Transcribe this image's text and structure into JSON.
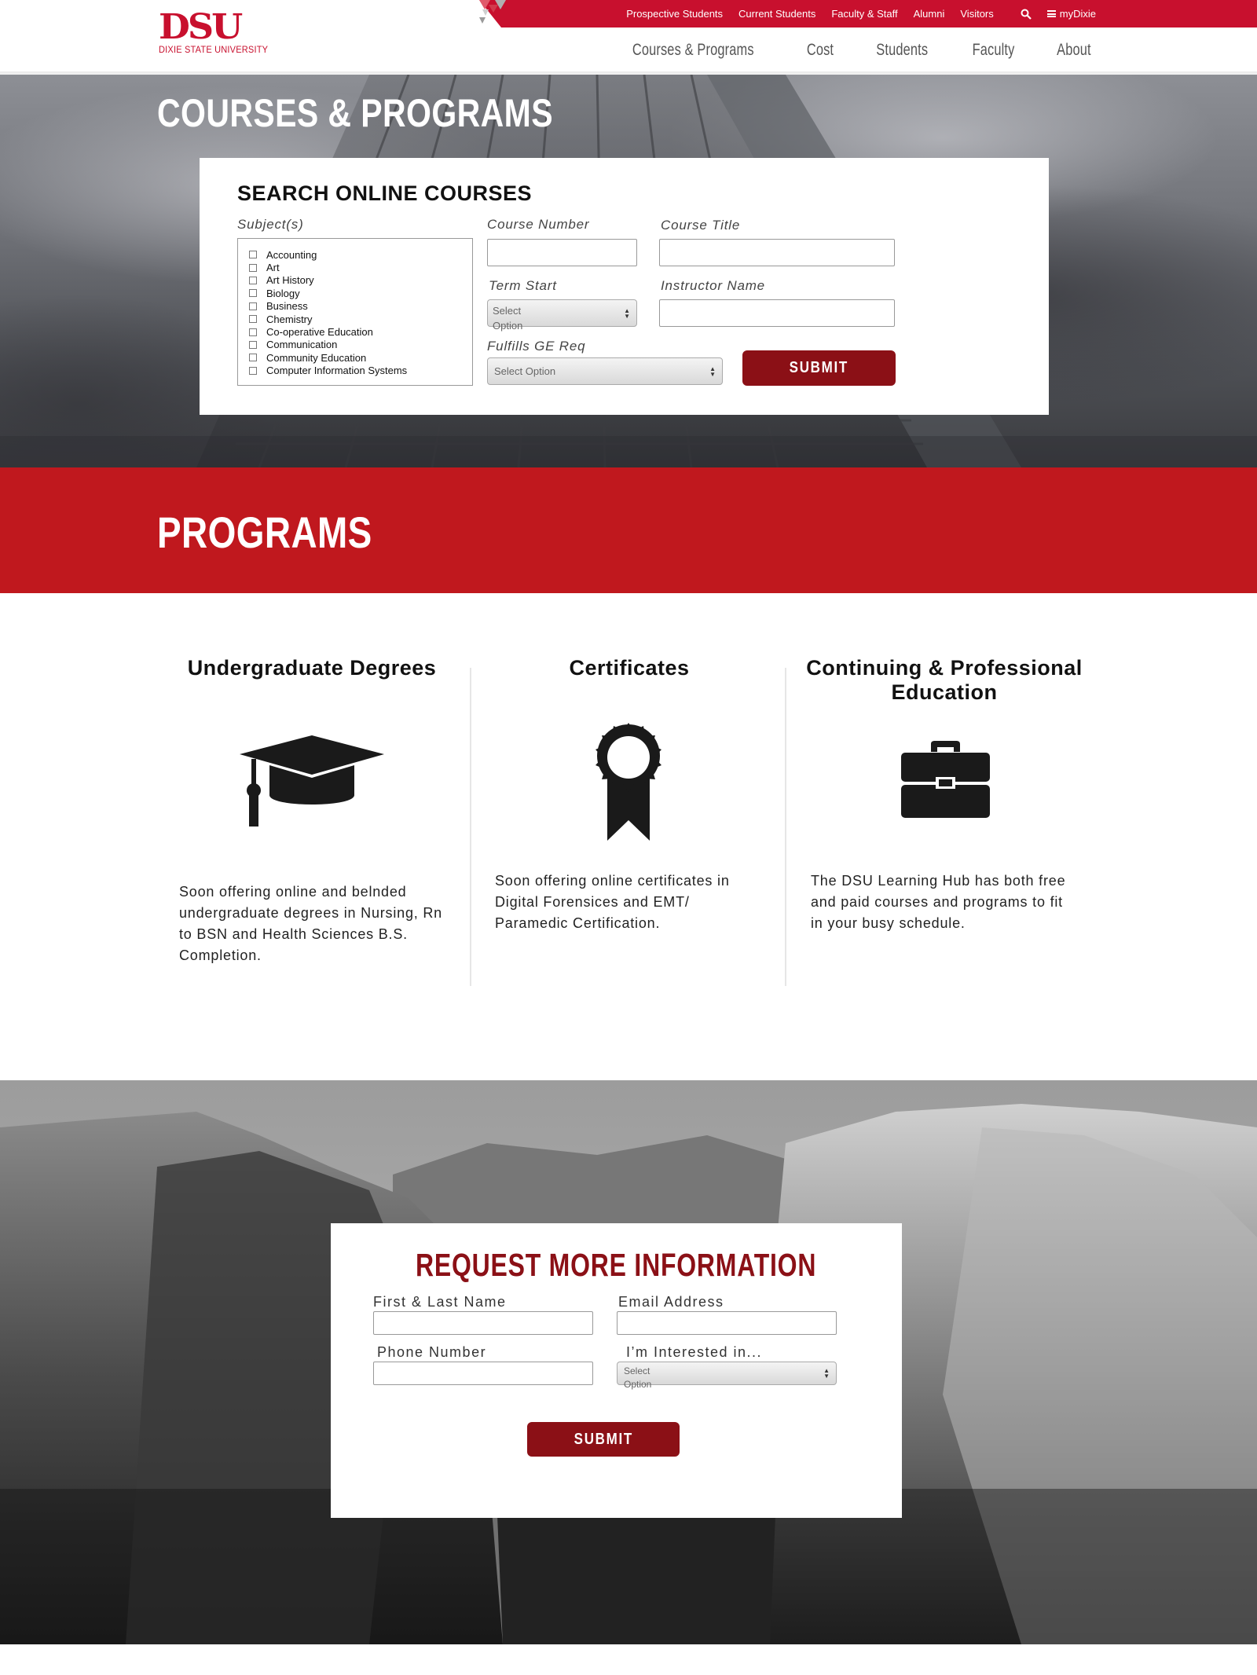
{
  "brand": {
    "logo_mark": "DSU",
    "logo_sub": "DIXIE STATE UNIVERSITY",
    "red": "#c8102e",
    "dark_red": "#8b1016"
  },
  "utility_nav": {
    "links": [
      "Prospective Students",
      "Current Students",
      "Faculty & Staff",
      "Alumni",
      "Visitors"
    ],
    "search_icon": "search-icon",
    "mydixie_label": "myDixie"
  },
  "main_nav": {
    "items": [
      "Courses & Programs",
      "Cost",
      "Students",
      "Faculty",
      "About"
    ]
  },
  "hero": {
    "title": "COURSES & PROGRAMS"
  },
  "search": {
    "title": "SEARCH ONLINE COURSES",
    "subjects_label": "Subject(s)",
    "subjects": [
      "Accounting",
      "Art",
      "Art History",
      "Biology",
      "Business",
      "Chemistry",
      "Co-operative Education",
      "Communication",
      "Community Education",
      "Computer Information Systems"
    ],
    "course_number_label": "Course Number",
    "course_title_label": "Course Title",
    "term_start_label": "Term Start",
    "term_start_value": "Select Option",
    "instructor_label": "Instructor Name",
    "ge_label": "Fulfills GE Req",
    "ge_value": "Select Option",
    "submit_label": "SUBMIT"
  },
  "programs": {
    "title": "PROGRAMS",
    "columns": [
      {
        "heading": "Undergraduate Degrees",
        "icon": "graduation-cap-icon",
        "description": "Soon offering online and belnded undergraduate degrees in Nursing, Rn to BSN and Health Sciences B.S. Completion."
      },
      {
        "heading": "Certificates",
        "icon": "award-ribbon-icon",
        "description": "Soon offering online certificates in Digital Forensices and EMT/ Paramedic Certification."
      },
      {
        "heading": "Continuing & Professional Education",
        "icon": "briefcase-icon",
        "description": "The DSU Learning Hub has both free and paid courses and programs to fit in your busy schedule."
      }
    ]
  },
  "request_info": {
    "title": "REQUEST MORE INFORMATION",
    "name_label": "First & Last Name",
    "email_label": "Email Address",
    "phone_label": "Phone Number",
    "interest_label": "I’m Interested in...",
    "interest_value": "Select Option",
    "submit_label": "SUBMIT"
  }
}
